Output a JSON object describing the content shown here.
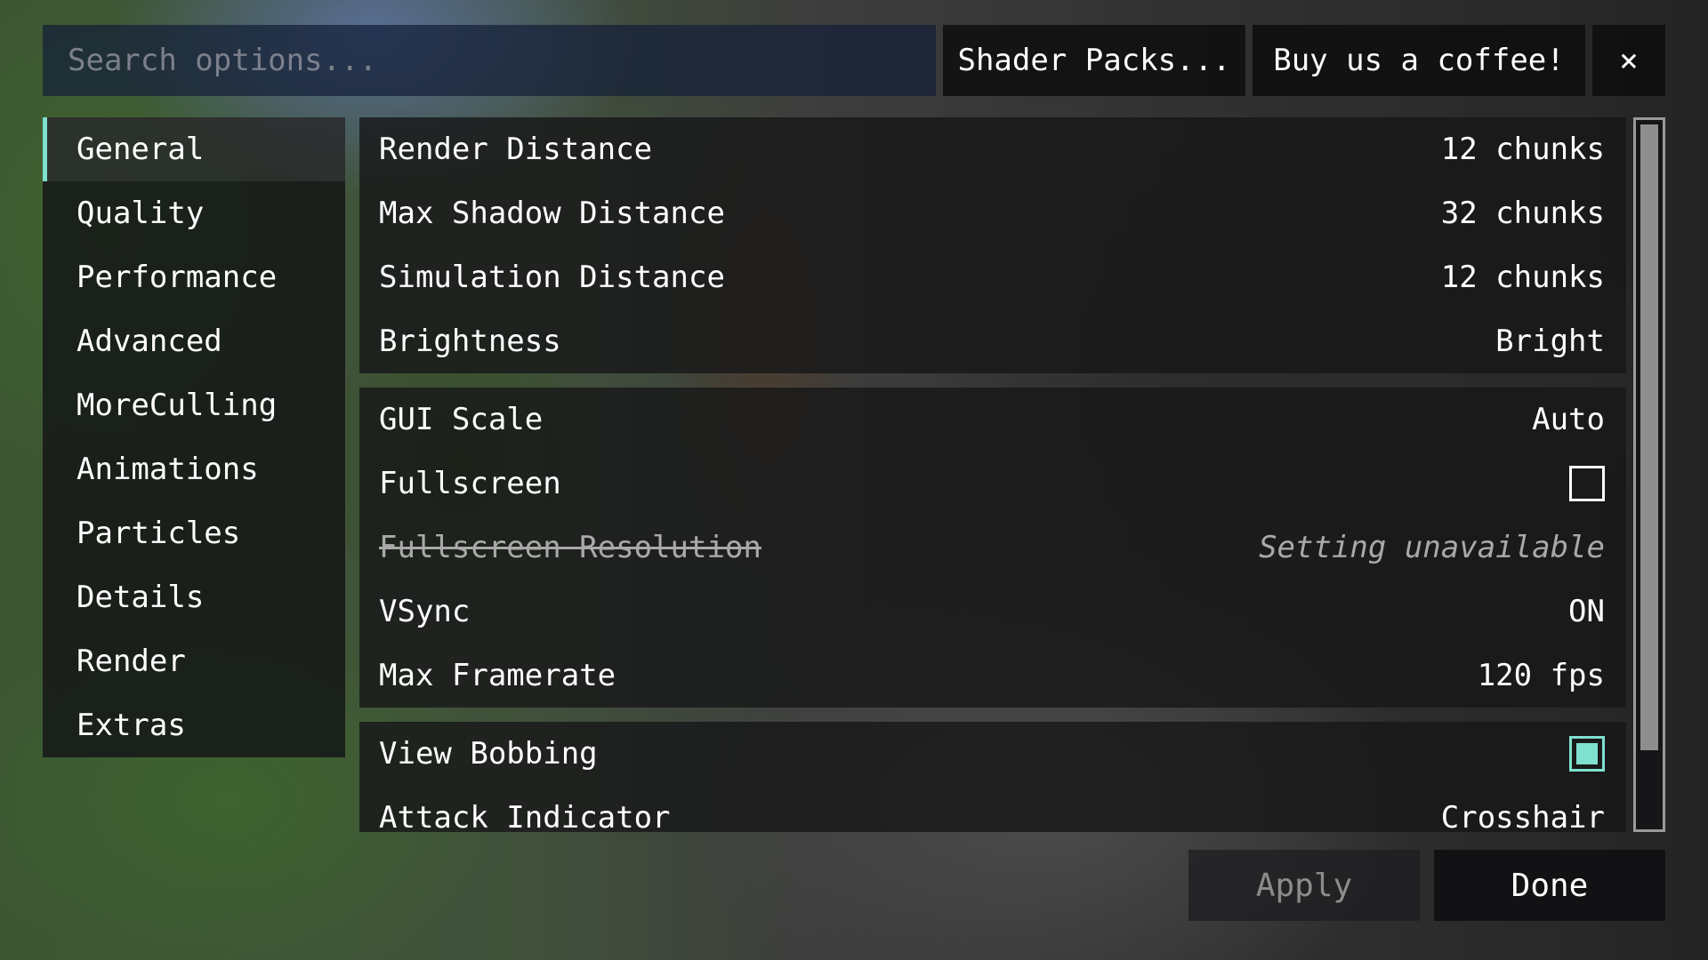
{
  "search": {
    "placeholder": "Search options..."
  },
  "topbar": {
    "shader_packs_label": "Shader Packs...",
    "coffee_label": "Buy us a coffee!",
    "close_label": "×"
  },
  "sidebar": {
    "active_index": 0,
    "accent_color": "#7fe0d0",
    "items": [
      {
        "label": "General"
      },
      {
        "label": "Quality"
      },
      {
        "label": "Performance"
      },
      {
        "label": "Advanced"
      },
      {
        "label": "MoreCulling"
      },
      {
        "label": "Animations"
      },
      {
        "label": "Particles"
      },
      {
        "label": "Details"
      },
      {
        "label": "Render"
      },
      {
        "label": "Extras"
      }
    ]
  },
  "options": {
    "groups": [
      {
        "rows": [
          {
            "label": "Render Distance",
            "value": "12 chunks"
          },
          {
            "label": "Max Shadow Distance",
            "value": "32 chunks"
          },
          {
            "label": "Simulation Distance",
            "value": "12 chunks"
          },
          {
            "label": "Brightness",
            "value": "Bright"
          }
        ]
      },
      {
        "rows": [
          {
            "label": "GUI Scale",
            "value": "Auto"
          },
          {
            "label": "Fullscreen",
            "checkbox": false
          },
          {
            "label": "Fullscreen Resolution",
            "value": "Setting unavailable",
            "disabled": true
          },
          {
            "label": "VSync",
            "value": "ON"
          },
          {
            "label": "Max Framerate",
            "value": "120 fps"
          }
        ]
      },
      {
        "rows": [
          {
            "label": "View Bobbing",
            "checkbox": true
          },
          {
            "label": "Attack Indicator",
            "value": "Crosshair"
          }
        ]
      }
    ]
  },
  "buttons": {
    "apply_label": "Apply",
    "apply_enabled": false,
    "done_label": "Done"
  }
}
